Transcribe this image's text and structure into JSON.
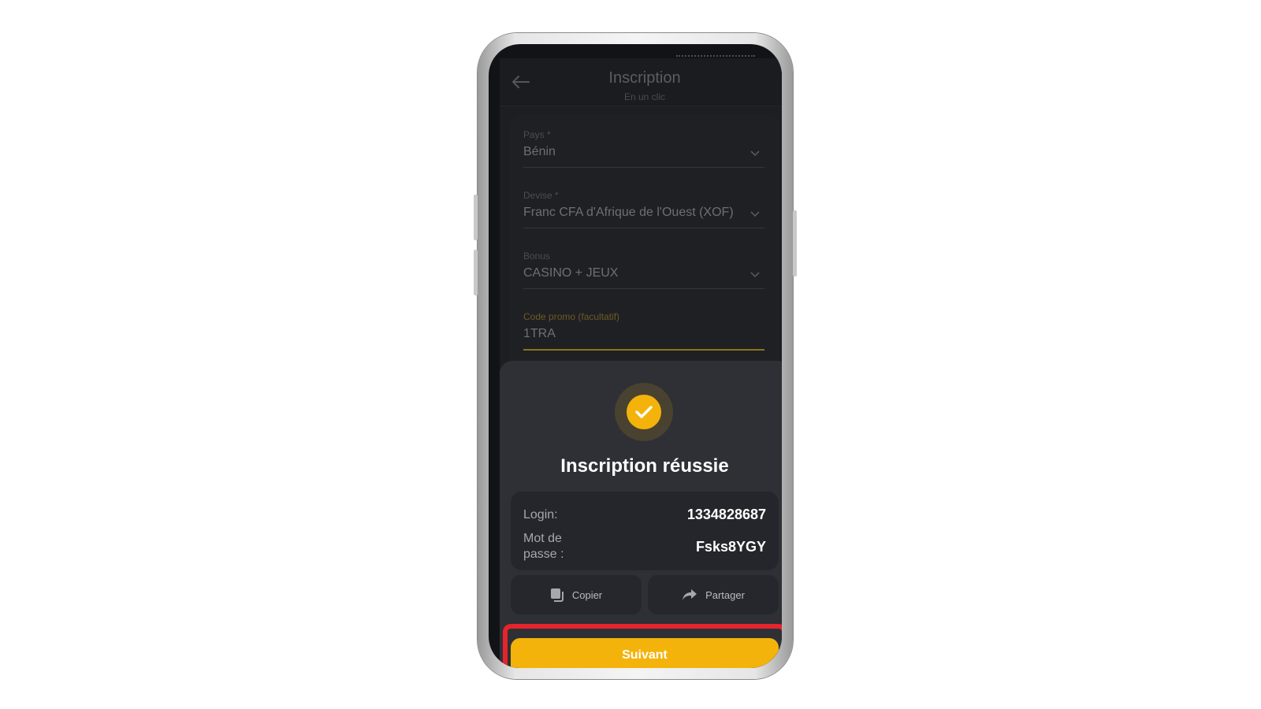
{
  "header": {
    "title": "Inscription",
    "subtitle": "En un clic"
  },
  "form": {
    "country": {
      "label": "Pays *",
      "value": "Bénin"
    },
    "currency": {
      "label": "Devise *",
      "value": "Franc CFA d'Afrique de l'Ouest (XOF)"
    },
    "bonus": {
      "label": "Bonus",
      "value": "CASINO + JEUX"
    },
    "promo": {
      "label": "Code promo (facultatif)",
      "value": "1TRA"
    }
  },
  "dialog": {
    "title": "Inscription réussie",
    "login_label": "Login:",
    "login_value": "1334828687",
    "password_label_line1": "Mot de",
    "password_label_line2": "passe :",
    "password_value": "Fsks8YGY",
    "copy_label": "Copier",
    "share_label": "Partager",
    "next_label": "Suivant"
  },
  "colors": {
    "accent": "#f4b30a",
    "highlight": "#e5242b",
    "background": "#1d1e22"
  },
  "icons": [
    "arrow-back-icon",
    "chevron-down-icon",
    "check-circle-icon",
    "copy-icon",
    "share-icon"
  ]
}
